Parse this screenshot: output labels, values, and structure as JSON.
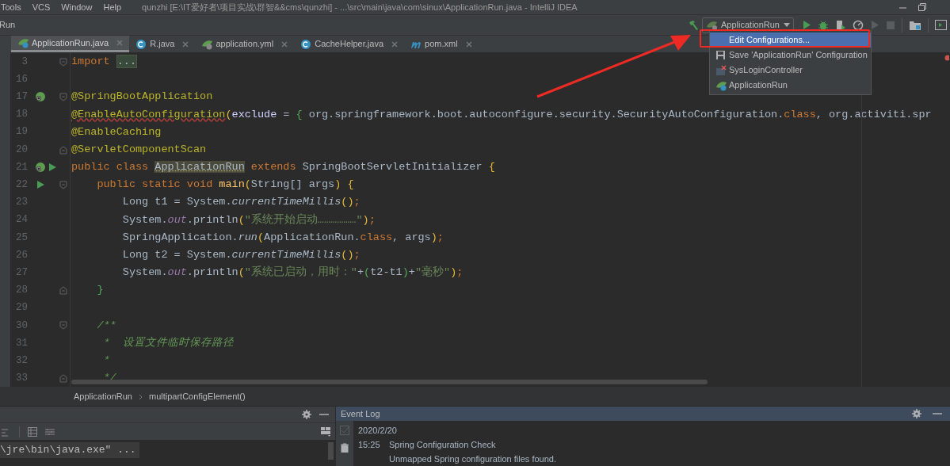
{
  "menu_bar": {
    "items": [
      "Tools",
      "VCS",
      "Window",
      "Help"
    ],
    "title": "qunzhi [E:\\IT爱好者\\项目实战\\群智&&cms\\qunzhi] - ...\\src\\main\\java\\com\\sinux\\ApplicationRun.java - IntelliJ IDEA"
  },
  "toolbar": {
    "label": "Run",
    "run_configuration": "ApplicationRun"
  },
  "config_menu": {
    "items": [
      {
        "label": "Edit Configurations...",
        "kind": "none",
        "selected": true
      },
      {
        "label": "Save 'ApplicationRun' Configuration",
        "kind": "save",
        "selected": false
      },
      {
        "label": "SysLoginController",
        "kind": "error",
        "selected": false
      },
      {
        "label": "ApplicationRun",
        "kind": "spring",
        "selected": false
      }
    ]
  },
  "tabs": [
    {
      "label": "ApplicationRun.java",
      "kind": "spring",
      "selected": true
    },
    {
      "label": "R.java",
      "kind": "class",
      "selected": false
    },
    {
      "label": "application.yml",
      "kind": "yml",
      "selected": false
    },
    {
      "label": "CacheHelper.java",
      "kind": "class",
      "selected": false
    },
    {
      "label": "pom.xml",
      "kind": "maven",
      "selected": false
    }
  ],
  "editor": {
    "lines": [
      {
        "number": "3",
        "fold_start": true,
        "tokens": [
          {
            "text": "import ",
            "kind": "keyword"
          },
          {
            "text": "...",
            "kind": "folded"
          }
        ]
      },
      {
        "number": "16"
      },
      {
        "number": "17",
        "fold_start": true,
        "spring_bean": true,
        "tokens": [
          {
            "text": "@SpringBootApplication",
            "kind": "annotation"
          }
        ]
      },
      {
        "number": "18",
        "tokens": [
          {
            "text": "@EnableAutoConfiguration",
            "kind": "annotation_error"
          },
          {
            "text": "(",
            "kind": "paren"
          },
          {
            "text": "exclude",
            "kind": "param"
          },
          {
            "text": " = ",
            "kind": "plain"
          },
          {
            "text": "{",
            "kind": "brace"
          },
          {
            "text": " org.springframework.boot.autoconfigure.security.SecurityAutoConfiguration.",
            "kind": "plain"
          },
          {
            "text": "class",
            "kind": "keyword"
          },
          {
            "text": ", org.activiti.spr",
            "kind": "plain"
          }
        ]
      },
      {
        "number": "19",
        "tokens": [
          {
            "text": "@EnableCaching",
            "kind": "annotation"
          }
        ]
      },
      {
        "number": "20",
        "fold_end": true,
        "tokens": [
          {
            "text": "@ServletComponentScan",
            "kind": "annotation"
          }
        ]
      },
      {
        "number": "21",
        "spring_bean": true,
        "runnable": true,
        "tokens": [
          {
            "text": "public class ",
            "kind": "keyword"
          },
          {
            "text": "ApplicationRun",
            "kind": "highlight"
          },
          {
            "text": " extends ",
            "kind": "keyword"
          },
          {
            "text": "SpringBootServletInitializer ",
            "kind": "plain"
          },
          {
            "text": "{",
            "kind": "paren"
          }
        ]
      },
      {
        "number": "22",
        "fold_start": true,
        "runnable": true,
        "tokens": [
          {
            "text": "    public static void ",
            "kind": "keyword"
          },
          {
            "text": "main",
            "kind": "method"
          },
          {
            "text": "(",
            "kind": "paren"
          },
          {
            "text": "String[] args",
            "kind": "plain"
          },
          {
            "text": ")",
            "kind": "paren"
          },
          {
            "text": " {",
            "kind": "paren"
          }
        ]
      },
      {
        "number": "23",
        "tokens": [
          {
            "text": "        Long t1 = System.",
            "kind": "plain"
          },
          {
            "text": "currentTimeMillis",
            "kind": "static"
          },
          {
            "text": "()",
            "kind": "paren"
          },
          {
            "text": ";",
            "kind": "keyword"
          }
        ]
      },
      {
        "number": "24",
        "tokens": [
          {
            "text": "        System.",
            "kind": "plain"
          },
          {
            "text": "out",
            "kind": "field"
          },
          {
            "text": ".println",
            "kind": "plain"
          },
          {
            "text": "(",
            "kind": "paren"
          },
          {
            "text": "\"系统开始启动………………\"",
            "kind": "string"
          },
          {
            "text": ")",
            "kind": "paren"
          },
          {
            "text": ";",
            "kind": "keyword"
          }
        ]
      },
      {
        "number": "25",
        "tokens": [
          {
            "text": "        SpringApplication.",
            "kind": "plain"
          },
          {
            "text": "run",
            "kind": "static"
          },
          {
            "text": "(",
            "kind": "paren"
          },
          {
            "text": "ApplicationRun.",
            "kind": "plain"
          },
          {
            "text": "class",
            "kind": "keyword"
          },
          {
            "text": ", args",
            "kind": "plain"
          },
          {
            "text": ")",
            "kind": "paren"
          },
          {
            "text": ";",
            "kind": "keyword"
          }
        ]
      },
      {
        "number": "26",
        "tokens": [
          {
            "text": "        Long t2 = System.",
            "kind": "plain"
          },
          {
            "text": "currentTimeMillis",
            "kind": "static"
          },
          {
            "text": "()",
            "kind": "paren"
          },
          {
            "text": ";",
            "kind": "keyword"
          }
        ]
      },
      {
        "number": "27",
        "tokens": [
          {
            "text": "        System.",
            "kind": "plain"
          },
          {
            "text": "out",
            "kind": "field"
          },
          {
            "text": ".println",
            "kind": "plain"
          },
          {
            "text": "(",
            "kind": "paren"
          },
          {
            "text": "\"系统已启动，用时：\"",
            "kind": "string"
          },
          {
            "text": "+",
            "kind": "plain"
          },
          {
            "text": "(",
            "kind": "brace"
          },
          {
            "text": "t2-t1",
            "kind": "plain"
          },
          {
            "text": ")",
            "kind": "brace"
          },
          {
            "text": "+",
            "kind": "plain"
          },
          {
            "text": "\"毫秒\"",
            "kind": "string"
          },
          {
            "text": ")",
            "kind": "paren"
          },
          {
            "text": ";",
            "kind": "keyword"
          }
        ]
      },
      {
        "number": "28",
        "fold_end": true,
        "tokens": [
          {
            "text": "    }",
            "kind": "brace"
          }
        ]
      },
      {
        "number": "29"
      },
      {
        "number": "30",
        "fold_start": true,
        "tokens": [
          {
            "text": "    /**",
            "kind": "comment"
          }
        ]
      },
      {
        "number": "31",
        "tokens": [
          {
            "text": "     *  设置文件临时保存路径",
            "kind": "comment"
          }
        ]
      },
      {
        "number": "32",
        "tokens": [
          {
            "text": "     *",
            "kind": "comment"
          }
        ]
      },
      {
        "number": "33",
        "fold_end": true,
        "tokens": [
          {
            "text": "     */",
            "kind": "comment"
          }
        ]
      }
    ]
  },
  "breadcrumbs": [
    "ApplicationRun",
    "multipartConfigElement()"
  ],
  "run_panel": {
    "console_lines": [
      "\\jre\\bin\\java.exe\" ..."
    ]
  },
  "event_log": {
    "title": "Event Log",
    "date": "2020/2/20",
    "entries": [
      {
        "time": "15:25",
        "title": "Spring Configuration Check",
        "message": "Unmapped Spring configuration files found."
      }
    ]
  }
}
